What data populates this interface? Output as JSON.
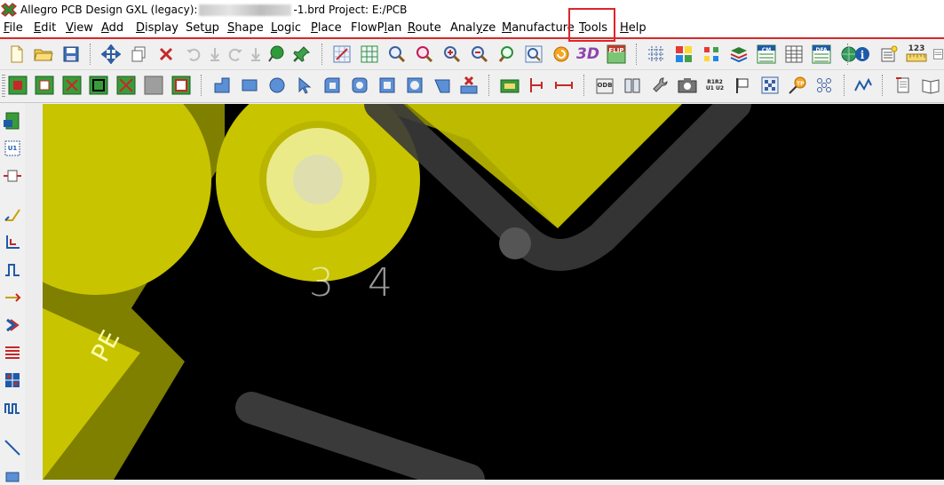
{
  "window": {
    "title_prefix": "Allegro PCB Design GXL (legacy):",
    "title_suffix": "-1.brd  Project: E:/PCB"
  },
  "menu": {
    "items": [
      {
        "label": "File",
        "accel": "F"
      },
      {
        "label": "Edit",
        "accel": "E"
      },
      {
        "label": "View",
        "accel": "V"
      },
      {
        "label": "Add",
        "accel": "A"
      },
      {
        "label": "Display",
        "accel": "D"
      },
      {
        "label": "Setup",
        "accel": "u"
      },
      {
        "label": "Shape",
        "accel": "S"
      },
      {
        "label": "Logic",
        "accel": "L"
      },
      {
        "label": "Place",
        "accel": "P"
      },
      {
        "label": "FlowPlan",
        "accel": "l"
      },
      {
        "label": "Route",
        "accel": "R"
      },
      {
        "label": "Analyze",
        "accel": "z"
      },
      {
        "label": "Manufacture",
        "accel": "M"
      },
      {
        "label": "Tools",
        "accel": "T"
      },
      {
        "label": "Help",
        "accel": "H"
      }
    ],
    "highlighted": "Tools"
  },
  "toolbar1": {
    "icons": [
      "new-file-icon",
      "open-folder-icon",
      "save-icon",
      "move-icon",
      "copy-icon",
      "delete-icon",
      "undo-icon",
      "redo-down-icon",
      "redo-icon",
      "redo-down-2-icon",
      "pin-green-icon",
      "pushpin-icon",
      "zoom-window-grid-icon",
      "zoom-fit-icon",
      "zoom-in-icon",
      "zoom-magnify-icon",
      "zoom-plus-icon",
      "zoom-minus-icon",
      "zoom-previous-icon",
      "zoom-world-icon",
      "refresh-icon",
      "view-3d-icon",
      "flip-icon",
      "grid-icon",
      "color-palette-icon",
      "layer-visibility-icon",
      "stack-layers-icon",
      "cm-icon",
      "spreadsheet-icon",
      "dfa-icon",
      "globe-icon",
      "info-icon",
      "property-icon",
      "ruler-icon"
    ],
    "labels": {
      "view-3d": "3D",
      "flip": "FLIP",
      "cm": "CM",
      "dfa": "DFA",
      "ruler": "123"
    }
  },
  "toolbar2": {
    "icons": [
      "add-pin-icon",
      "add-pin-2-icon",
      "add-via-icon",
      "add-shape-icon",
      "add-fill-icon",
      "gray-square-icon",
      "gray-outline-icon",
      "shape-corner-icon",
      "shape-rect-icon",
      "shape-circle-icon",
      "select-arrow-icon",
      "shape-round-rect-icon",
      "shape-rotate-icon",
      "shape-square-icon",
      "shape-circle-outline-icon",
      "shape-slant-icon",
      "shape-delete-icon",
      "text-icon",
      "dimension-icon",
      "measure-icon",
      "odb-icon",
      "book-icon",
      "wrench-icon",
      "camera-icon",
      "reference-designator-icon",
      "flag-icon",
      "checkerboard-icon",
      "test-point-icon",
      "matrix-icon",
      "route-icon",
      "paper-icon",
      "book-open-icon"
    ],
    "labels": {
      "odb": "ODB",
      "refdes": "R1R2 U1 U2",
      "test-point": "TP"
    }
  },
  "left_toolbar": {
    "icons": [
      "component-icon",
      "u1-icon",
      "device-icon",
      "line-icon",
      "route-corner-icon",
      "route-zigzag-icon",
      "route-connect-icon",
      "chevron-icon",
      "bus-icon",
      "matrix-grid-icon",
      "serpentine-icon",
      "diagonal-line-icon",
      "rect-bottom-icon"
    ],
    "labels": {
      "u1": "U1"
    }
  },
  "canvas": {
    "pad_label": "3 4",
    "silk_label": "PE",
    "colors": {
      "background": "#000000",
      "copper_shape": "#7f7f00",
      "copper_bright": "#c8c400",
      "trace": "#3a3a3a",
      "pad_highlight": "#f3f3a0"
    }
  },
  "colors": {
    "menu_highlight_box": "#e0242a",
    "menu_underline": "#d42a2a"
  }
}
